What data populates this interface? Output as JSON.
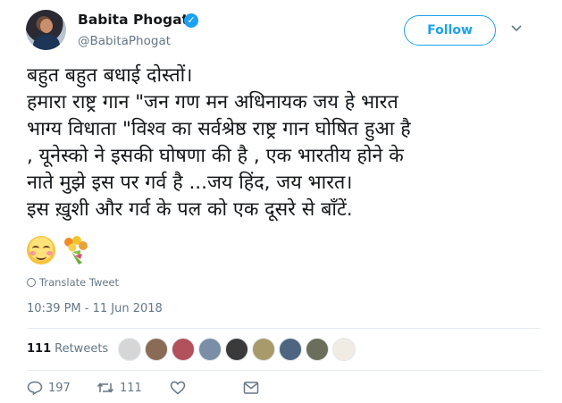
{
  "header": {
    "display_name": "Babita Phogat",
    "handle": "@BabitaPhogat",
    "verified_icon": "verified-check-icon",
    "follow_label": "Follow",
    "menu_icon": "chevron-down-icon"
  },
  "tweet": {
    "lines": [
      "बहुत बहुत बधाई दोस्तों।",
      "हमारा राष्ट्र गान \"जन गण मन अधिनायक जय हे भारत",
      "भाग्य विधाता \"विश्व का सर्वश्रेष्ठ राष्ट्र गान घोषित हुआ है",
      ", यूनेस्को ने इसकी घोषणा की है , एक भारतीय होने के",
      "नाते मुझे इस पर गर्व है ...जय हिंद, जय भारत।",
      " इस ख़ुशी और गर्व के पल को एक दूसरे से बाँटें."
    ],
    "emojis": [
      "smiling-face-icon",
      "bouquet-icon"
    ],
    "translate_label": "Translate Tweet",
    "timestamp": "10:39 PM - 11 Jun 2018"
  },
  "stats": {
    "retweet_count": "111",
    "retweet_label": "Retweets"
  },
  "actions": {
    "reply_count": "197",
    "retweet_count": "111",
    "like_count": "",
    "icons": [
      "reply-icon",
      "retweet-icon",
      "like-icon",
      "direct-message-icon"
    ]
  },
  "colors": {
    "accent": "#1da1f2",
    "muted": "#657786",
    "text": "#14171a",
    "divider": "#e6ecf0"
  }
}
